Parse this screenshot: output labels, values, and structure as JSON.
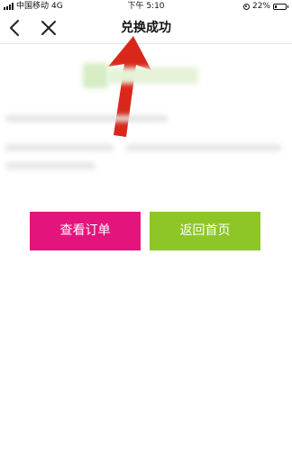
{
  "status_bar": {
    "carrier": "中国移动",
    "network": "4G",
    "time": "下午 5:10",
    "battery_percent": "22%",
    "battery_level": 0.22
  },
  "nav": {
    "title": "兑换成功",
    "back_icon": "chevron-left-icon",
    "close_icon": "close-icon"
  },
  "actions": {
    "view_orders_label": "查看订单",
    "home_label": "返回首页"
  },
  "colors": {
    "view_orders_bg": "#e3157d",
    "home_bg": "#8ec628",
    "annotation_arrow": "#d9271c"
  }
}
